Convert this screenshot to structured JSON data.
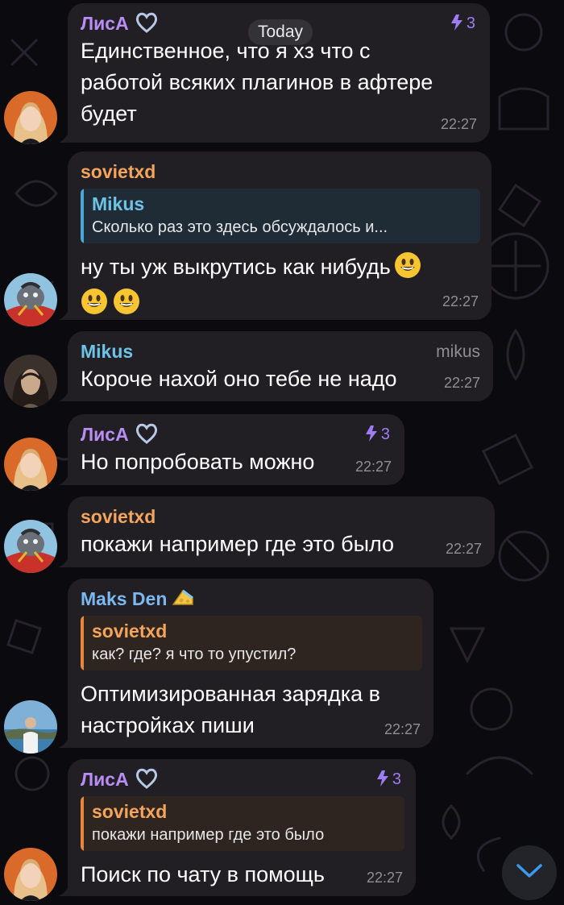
{
  "date_label": "Today",
  "colors": {
    "lisa": "#b98ef4",
    "sovietxd": "#f5a45b",
    "mikus": "#6ec2e6",
    "maks": "#7bb8f0",
    "boost": "#9d7cf5",
    "bubble": "#211f24",
    "time": "#8e8e93"
  },
  "messages": [
    {
      "sender": "ЛисА",
      "boost": "3",
      "lines": [
        "Единственное, что я хз что с",
        "работой всяких плагинов в афтере",
        "будет"
      ],
      "time": "22:27"
    },
    {
      "sender": "sovietxd",
      "reply": {
        "name": "Mikus",
        "text": "Сколько раз это здесь обсуждалось и..."
      },
      "lines": [
        "ну ты уж выкрутись как нибудь"
      ],
      "time": "22:27"
    },
    {
      "sender": "Mikus",
      "handle": "mikus",
      "lines": [
        "Короче нахой оно тебе не надо"
      ],
      "time": "22:27"
    },
    {
      "sender": "ЛисА",
      "boost": "3",
      "lines": [
        "Но попробовать можно"
      ],
      "time": "22:27"
    },
    {
      "sender": "sovietxd",
      "lines": [
        "покажи например где это было"
      ],
      "time": "22:27"
    },
    {
      "sender": "Maks Den",
      "reply": {
        "name": "sovietxd",
        "text": "как? где? я что то упустил?"
      },
      "lines": [
        "Оптимизированная зарядка в",
        "настройках пиши"
      ],
      "time": "22:27"
    },
    {
      "sender": "ЛисА",
      "boost": "3",
      "reply": {
        "name": "sovietxd",
        "text": "покажи например где это было"
      },
      "lines": [
        "Поиск по чату в помощь"
      ],
      "time": "22:27"
    }
  ],
  "icons": {
    "heart": "heart-outline-icon",
    "boost": "boost-lightning-icon",
    "emoji": "smiley-emoji-icon",
    "scroll": "chevron-down-icon"
  }
}
